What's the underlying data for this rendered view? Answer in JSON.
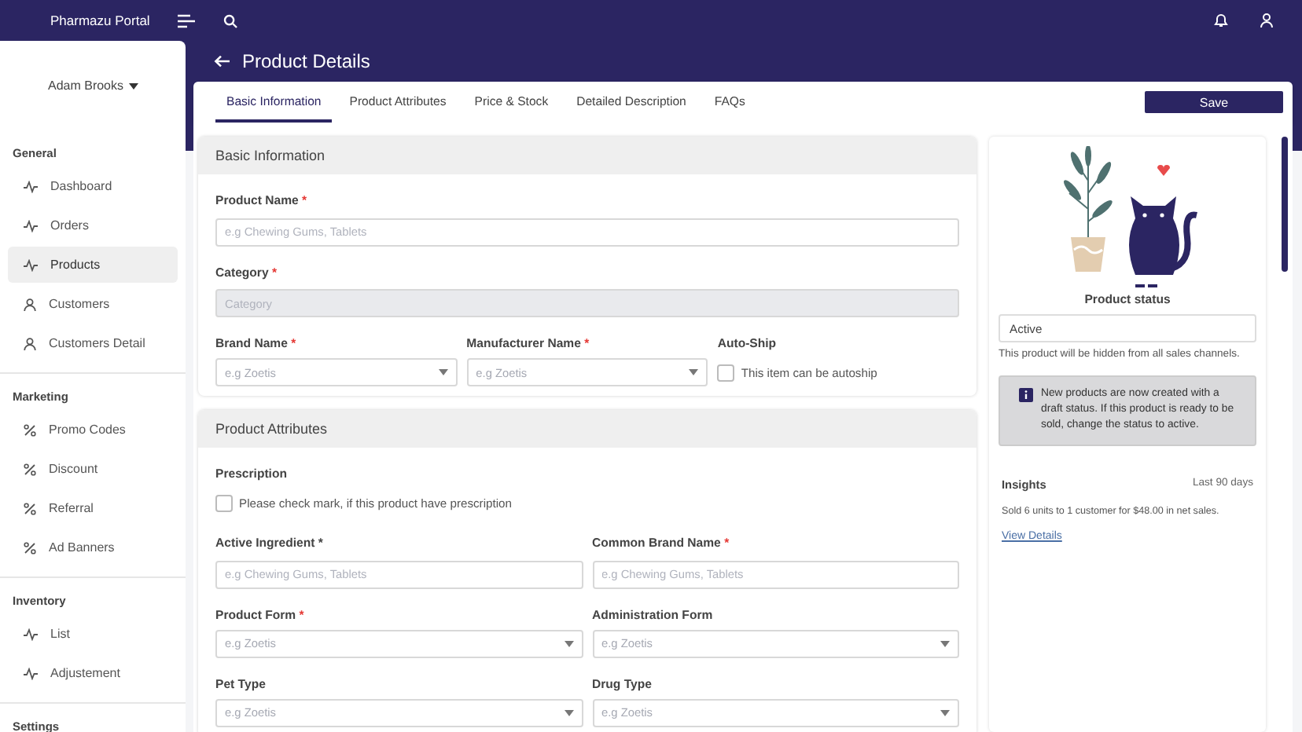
{
  "app": {
    "title": "Pharmazu Portal"
  },
  "sidebar": {
    "user_name": "Adam Brooks",
    "sections": [
      {
        "title": "General",
        "items": [
          {
            "label": "Dashboard",
            "kind": "activity",
            "selected": false
          },
          {
            "label": "Orders",
            "kind": "activity",
            "selected": false
          },
          {
            "label": "Products",
            "kind": "activity",
            "selected": true
          },
          {
            "label": "Customers",
            "kind": "user",
            "selected": false
          },
          {
            "label": "Customers Detail",
            "kind": "user",
            "selected": false
          }
        ]
      },
      {
        "title": "Marketing",
        "items": [
          {
            "label": "Promo Codes",
            "kind": "percent",
            "selected": false
          },
          {
            "label": "Discount",
            "kind": "percent",
            "selected": false
          },
          {
            "label": "Referral",
            "kind": "percent",
            "selected": false
          },
          {
            "label": "Ad Banners",
            "kind": "percent",
            "selected": false
          }
        ]
      },
      {
        "title": "Inventory",
        "items": [
          {
            "label": "List",
            "kind": "activity",
            "selected": false
          },
          {
            "label": "Adjustement",
            "kind": "activity",
            "selected": false
          }
        ]
      },
      {
        "title": "Settings"
      }
    ]
  },
  "page_title": "Product Details",
  "tabs": [
    {
      "label": "Basic Information",
      "selected": true
    },
    {
      "label": "Product Attributes",
      "selected": false
    },
    {
      "label": "Price & Stock",
      "selected": false
    },
    {
      "label": "Detailed Description",
      "selected": false
    },
    {
      "label": "FAQs",
      "selected": false
    }
  ],
  "save_button": "Save",
  "sections": [
    {
      "title": "Basic Information",
      "rows": [
        [
          {
            "kind": "text",
            "label": "Product Name",
            "required_mark": "*",
            "placeholder": "e.g Chewing Gums, Tablets"
          }
        ],
        [
          {
            "kind": "disabled",
            "label": "Category",
            "required_mark": "*",
            "placeholder": "Category"
          }
        ],
        [
          {
            "kind": "select",
            "label": "Brand Name",
            "required_mark": "*",
            "placeholder": "e.g Zoetis"
          },
          {
            "kind": "select",
            "label": "Manufacturer Name",
            "required_mark": "*",
            "placeholder": "e.g Zoetis"
          },
          {
            "kind": "checkbox",
            "label": "Auto-Ship",
            "text": "This item can be autoship",
            "checked": false
          }
        ]
      ]
    },
    {
      "title": "Product Attributes",
      "rows": [
        [
          {
            "kind": "checkbox",
            "label": "Prescription",
            "text": "Please check mark, if this product have prescription",
            "checked": false
          }
        ],
        [
          {
            "kind": "text",
            "label": "Active Ingredient *",
            "placeholder": "e.g Chewing Gums, Tablets"
          },
          {
            "kind": "text",
            "label": "Common Brand Name",
            "required_mark": "*",
            "placeholder": "e.g Chewing Gums, Tablets"
          }
        ],
        [
          {
            "kind": "select",
            "label": "Product Form",
            "required_mark": "*",
            "placeholder": "e.g Zoetis"
          },
          {
            "kind": "select",
            "label": "Administration Form",
            "placeholder": "e.g Zoetis"
          }
        ],
        [
          {
            "kind": "select",
            "label": "Pet Type",
            "placeholder": "e.g Zoetis"
          },
          {
            "kind": "select",
            "label": "Drug Type",
            "placeholder": "e.g Zoetis"
          }
        ]
      ]
    }
  ],
  "status": {
    "title": "Product status",
    "value": "Active",
    "note": "This product will be hidden from all sales channels.",
    "info": "New products are now created with a draft status. If this product is ready to be sold, change the status to active."
  },
  "insights": {
    "title": "Insights",
    "period": "Last 90 days",
    "summary": "Sold 6 units to 1 customer for $48.00 in net sales.",
    "link": "View Details"
  }
}
